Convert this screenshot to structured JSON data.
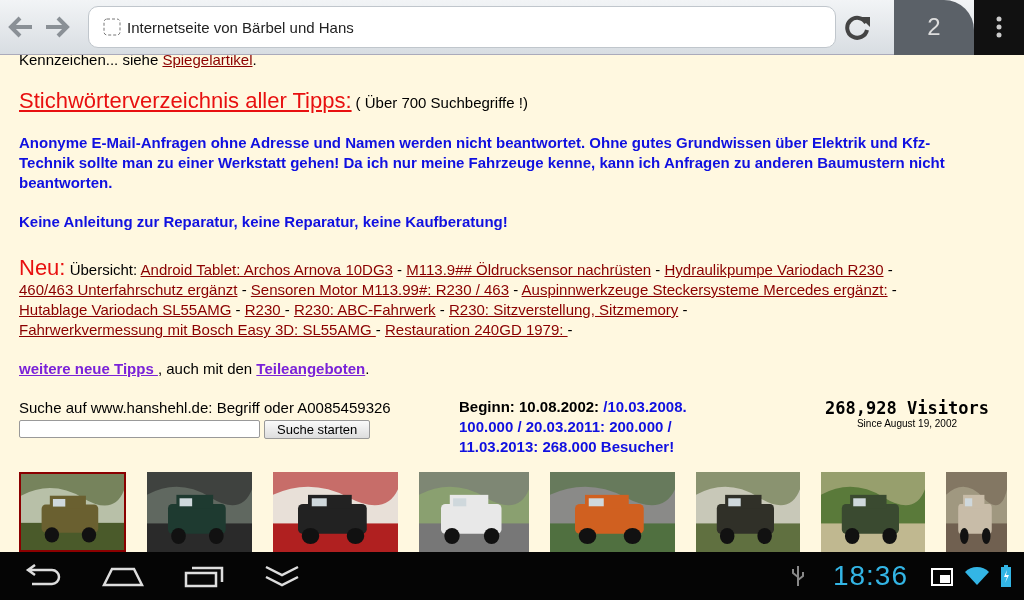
{
  "browser": {
    "page_title": "Internetseite von Bärbel und Hans",
    "tab_count": "2"
  },
  "page": {
    "top_line": [
      {
        "kind": "text",
        "text": "Kennzeichen... siehe "
      },
      {
        "kind": "link",
        "text": "Spiegelartikel"
      },
      {
        "kind": "text",
        "text": "."
      }
    ],
    "index_link": "Stichwörterverzeichnis aller Tipps:",
    "index_note": "( Über 700 Suchbegriffe !)",
    "notices": [
      "Anonyme E-Mail-Anfragen ohne Adresse und Namen werden nicht beantwortet. Ohne gutes Grundwissen über Elektrik und Kfz-Technik sollte man zu einer Werkstatt gehen! Da ich nur meine Fahrzeuge kenne, kann ich Anfragen zu anderen Baumustern nicht beantworten.",
      "Keine Anleitung zur Reparatur, keine Reparatur, keine Kaufberatung!"
    ],
    "news_label": "Neu:",
    "news": [
      {
        "kind": "text",
        "text": "Übersicht: "
      },
      {
        "kind": "link",
        "text": "Android Tablet: Archos Arnova 10DG3"
      },
      {
        "kind": "text",
        "text": " - "
      },
      {
        "kind": "link",
        "text": "M113.9## Öldrucksensor nachrüsten"
      },
      {
        "kind": "text",
        "text": " - "
      },
      {
        "kind": "link",
        "text": "Hydraulikpumpe Variodach R230"
      },
      {
        "kind": "text",
        "text": " - "
      },
      {
        "kind": "link",
        "text": "460/463 Unterfahrschutz ergänzt"
      },
      {
        "kind": "text",
        "text": " - "
      },
      {
        "kind": "link",
        "text": "Sensoren Motor M113.99#: R230 / 463"
      },
      {
        "kind": "text",
        "text": " - "
      },
      {
        "kind": "link",
        "text": "Auspinnwerkzeuge Steckersysteme Mercedes ergänzt:"
      },
      {
        "kind": "text",
        "text": " - "
      },
      {
        "kind": "link",
        "text": "Hutablage Variodach SL55AMG"
      },
      {
        "kind": "text",
        "text": " - "
      },
      {
        "kind": "link",
        "text": "R230 "
      },
      {
        "kind": "text",
        "text": " - "
      },
      {
        "kind": "link",
        "text": "R230: ABC-Fahrwerk"
      },
      {
        "kind": "text",
        "text": " - "
      },
      {
        "kind": "link",
        "text": "R230: Sitzverstellung, Sitzmemory"
      },
      {
        "kind": "text",
        "text": " - "
      },
      {
        "kind": "link",
        "text": "Fahrwerkvermessung mit Bosch Easy 3D: SL55AMG "
      },
      {
        "kind": "text",
        "text": " - "
      },
      {
        "kind": "link",
        "text": "Restauration 240GD 1979: "
      },
      {
        "kind": "text",
        "text": " -"
      }
    ],
    "more_line": [
      {
        "kind": "visited",
        "text": "weitere neue Tipps "
      },
      {
        "kind": "text",
        "text": ", auch mit den "
      },
      {
        "kind": "visited",
        "text": "Teileangeboten"
      },
      {
        "kind": "text",
        "text": "."
      }
    ],
    "search": {
      "label": "Suche auf www.hanshehl.de: Begriff oder A0085459326",
      "button": "Suche starten"
    },
    "counter": [
      {
        "kind": "strong",
        "text": "Beginn: 10.08.2002: "
      },
      {
        "kind": "blue",
        "text": "/10.03.2008. 100.000 / 20.03.2011: 200.000 / 11.03.2013: 268.000 Besucher!"
      }
    ],
    "visitors": {
      "count": "268,928 Visitors",
      "since": "Since August 19, 2002"
    },
    "thumbnails": [
      {
        "kind": "picture",
        "selected": true
      },
      {
        "kind": "picture",
        "selected": false
      },
      {
        "kind": "picture",
        "selected": false
      },
      {
        "kind": "picture",
        "selected": false
      },
      {
        "kind": "picture",
        "selected": false
      },
      {
        "kind": "picture",
        "selected": false
      },
      {
        "kind": "picture",
        "selected": false
      },
      {
        "kind": "picture",
        "selected": false
      }
    ]
  },
  "system_bar": {
    "time": "18:36"
  }
}
